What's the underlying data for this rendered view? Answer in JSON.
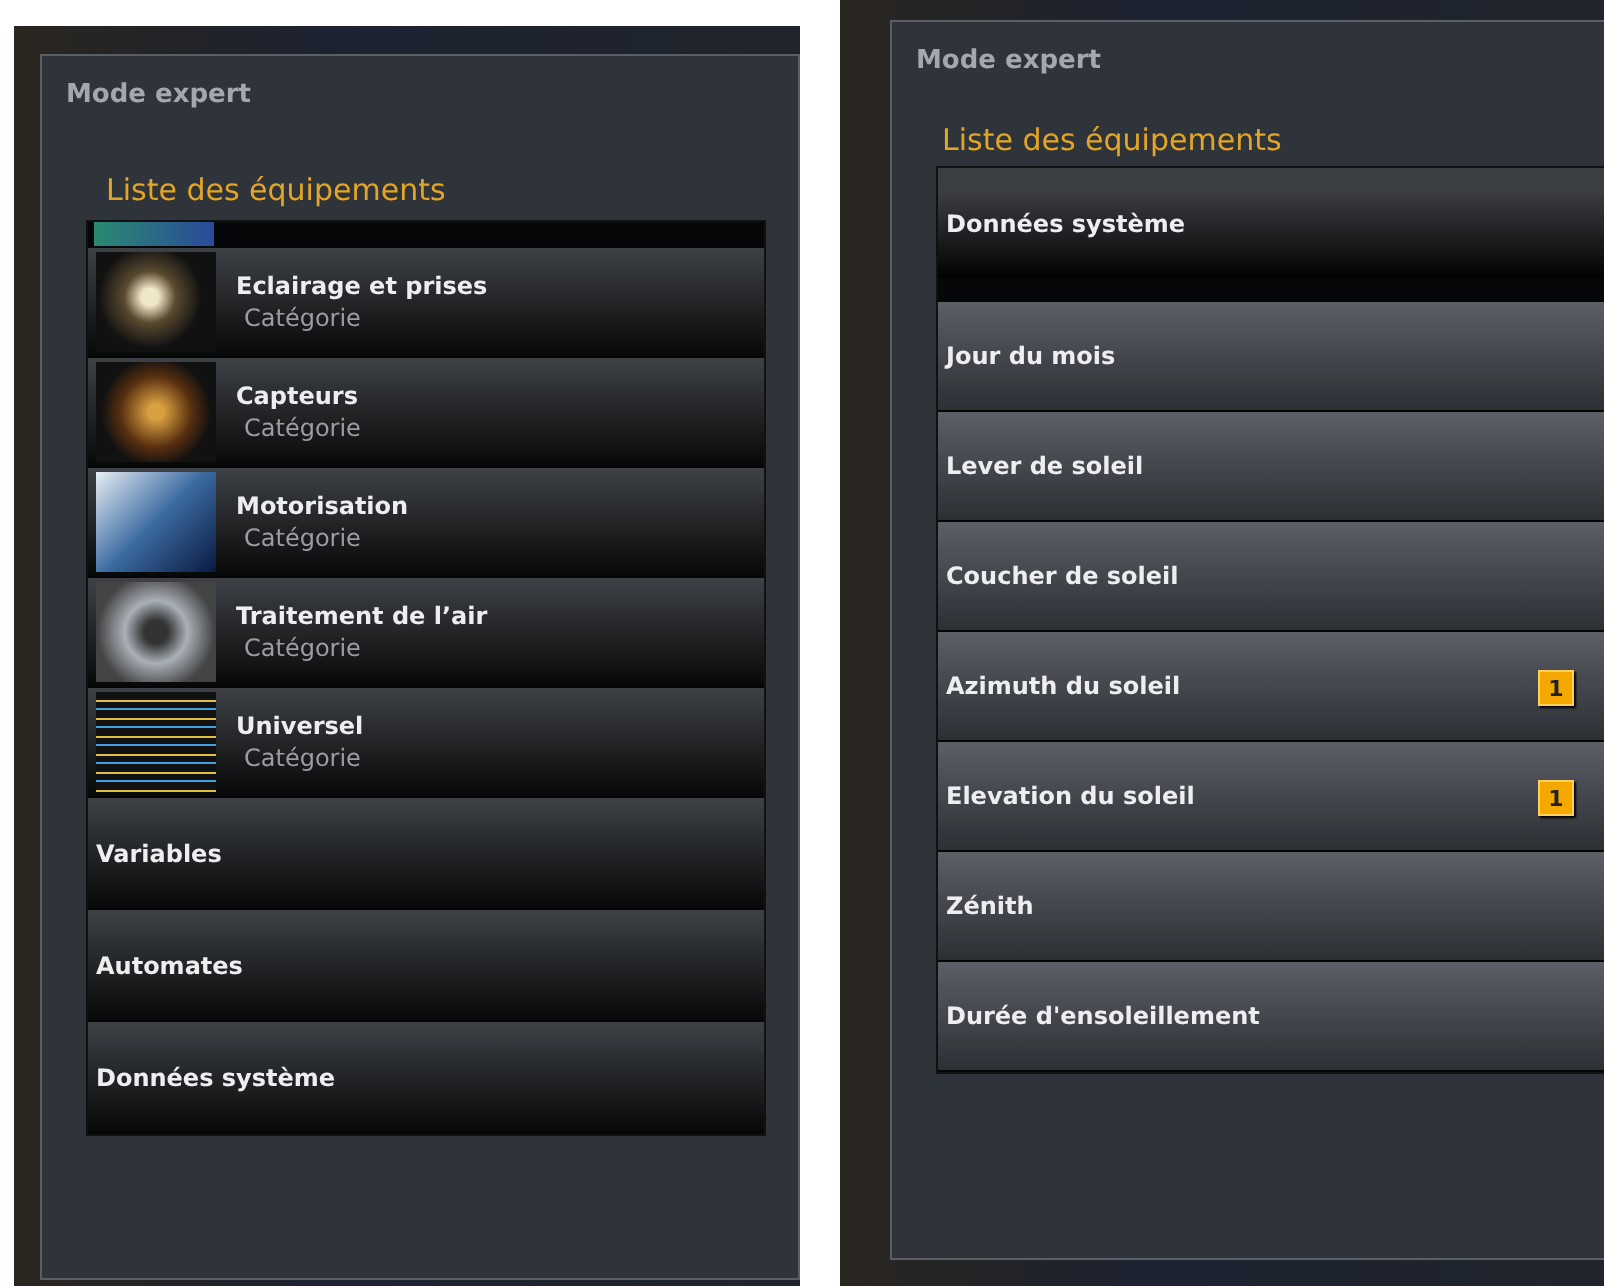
{
  "screens": [
    {
      "title": "Mode expert",
      "heading": "Liste des équipements",
      "items": [
        {
          "kind": "category",
          "label": "Eclairage et prises",
          "subtitle": "Catégorie"
        },
        {
          "kind": "category",
          "label": "Capteurs",
          "subtitle": "Catégorie"
        },
        {
          "kind": "category",
          "label": "Motorisation",
          "subtitle": "Catégorie"
        },
        {
          "kind": "category",
          "label": "Traitement de l’air",
          "subtitle": "Catégorie"
        },
        {
          "kind": "category",
          "label": "Universel",
          "subtitle": "Catégorie"
        },
        {
          "kind": "plain",
          "label": "Variables"
        },
        {
          "kind": "plain",
          "label": "Automates"
        },
        {
          "kind": "plain",
          "label": "Données système"
        }
      ]
    },
    {
      "title": "Mode expert",
      "heading": "Liste des équipements",
      "items": [
        {
          "kind": "header",
          "label": "Données système"
        },
        {
          "kind": "value",
          "label": "Jour du mois"
        },
        {
          "kind": "value",
          "label": "Lever de soleil"
        },
        {
          "kind": "value",
          "label": "Coucher de soleil"
        },
        {
          "kind": "value",
          "label": "Azimuth du soleil",
          "badge": "1"
        },
        {
          "kind": "value",
          "label": "Elevation du soleil",
          "badge": "1"
        },
        {
          "kind": "value",
          "label": "Zénith"
        },
        {
          "kind": "value",
          "label": "Durée d'ensoleillement"
        }
      ]
    }
  ]
}
